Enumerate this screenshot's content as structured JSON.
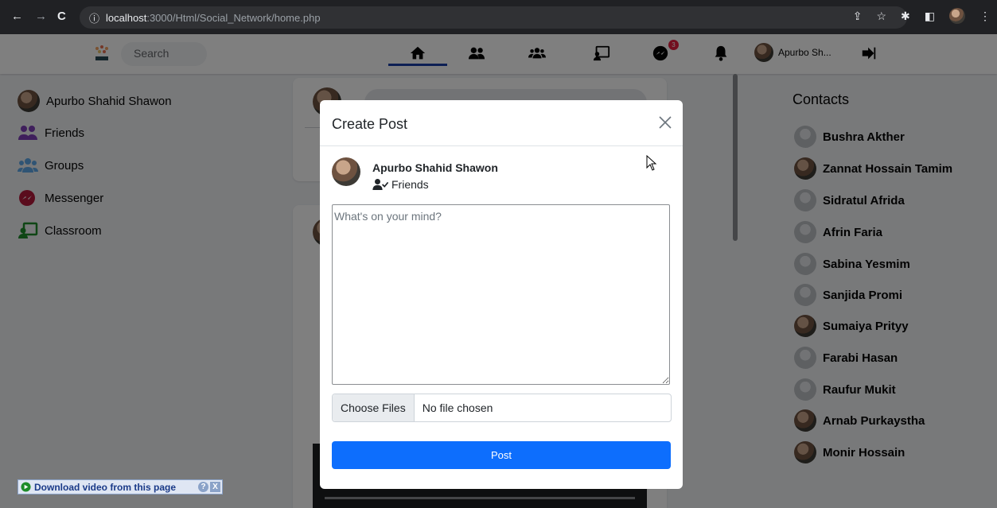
{
  "browser": {
    "url_host": "localhost",
    "url_path": ":3000/Html/Social_Network/home.php"
  },
  "topnav": {
    "search_label": "Search",
    "messenger_badge": "3",
    "profile_name": "Apurbo Sh..."
  },
  "sidebar": {
    "items": [
      {
        "label": "Apurbo Shahid Shawon"
      },
      {
        "label": "Friends"
      },
      {
        "label": "Groups"
      },
      {
        "label": "Messenger"
      },
      {
        "label": "Classroom"
      }
    ]
  },
  "contacts": {
    "title": "Contacts",
    "items": [
      {
        "name": "Bushra Akther"
      },
      {
        "name": "Zannat Hossain Tamim"
      },
      {
        "name": "Sidratul Afrida"
      },
      {
        "name": "Afrin Faria"
      },
      {
        "name": "Sabina Yesmim"
      },
      {
        "name": "Sanjida Promi"
      },
      {
        "name": "Sumaiya Prityy"
      },
      {
        "name": "Farabi Hasan"
      },
      {
        "name": "Raufur Mukit"
      },
      {
        "name": "Arnab Purkaystha"
      },
      {
        "name": "Monir Hossain"
      }
    ]
  },
  "modal": {
    "title": "Create Post",
    "author": "Apurbo Shahid Shawon",
    "audience": "Friends",
    "placeholder": "What's on your mind?",
    "file_button": "Choose Files",
    "file_status": "No file chosen",
    "post_button": "Post"
  },
  "download_widget": {
    "label": "Download video from this page"
  },
  "colors": {
    "primary": "#0d6efd",
    "purple": "#7e3fb8",
    "badge": "#e41e3f"
  }
}
